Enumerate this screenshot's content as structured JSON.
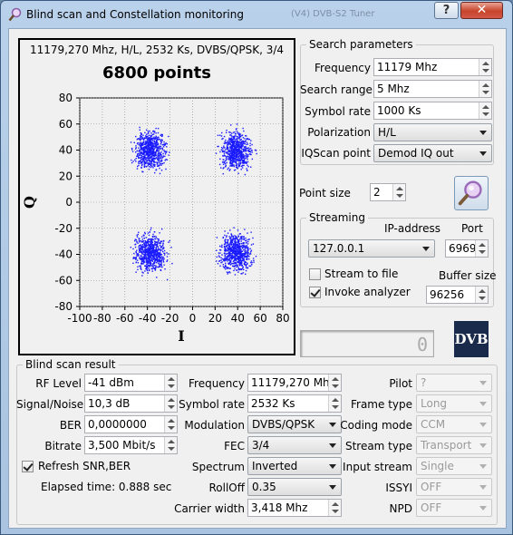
{
  "window": {
    "title": "Blind scan and Constellation monitoring",
    "bg_title": "(V4) DVB-S2 Tuner",
    "help": "?",
    "close": "✕"
  },
  "plot": {
    "header": "11179,270 Mhz, H/L, 2532 Ks, DVBS/QPSK, 3/4",
    "title": "6800 points",
    "xlabel": "I",
    "ylabel": "Q"
  },
  "chart_data": {
    "type": "scatter",
    "title": "6800 points",
    "xlabel": "I",
    "ylabel": "Q",
    "xlim": [
      -100,
      80
    ],
    "ylim": [
      -80,
      80
    ],
    "xticks": [
      -100,
      -80,
      -60,
      -40,
      -20,
      0,
      20,
      40,
      60,
      80
    ],
    "yticks": [
      -80,
      -60,
      -40,
      -20,
      0,
      20,
      40,
      60,
      80
    ],
    "grid": true,
    "point_count": 6800,
    "color": "#1a1aff",
    "clusters": [
      {
        "center": [
          -38,
          40
        ],
        "spread": 10
      },
      {
        "center": [
          38,
          40
        ],
        "spread": 10
      },
      {
        "center": [
          -38,
          -38
        ],
        "spread": 10
      },
      {
        "center": [
          38,
          -38
        ],
        "spread": 10
      }
    ]
  },
  "search": {
    "legend": "Search parameters",
    "frequency_label": "Frequency",
    "frequency_value": "11179 Mhz",
    "range_label": "Search range",
    "range_value": "5 Mhz",
    "symrate_label": "Symbol rate",
    "symrate_value": "1000 Ks",
    "pol_label": "Polarization",
    "pol_value": "H/L",
    "iq_label": "IQScan point",
    "iq_value": "Demod IQ out"
  },
  "pointsize": {
    "label": "Point size",
    "value": "2"
  },
  "streaming": {
    "legend": "Streaming",
    "ip_label": "IP-address",
    "ip_value": "127.0.0.1",
    "port_label": "Port",
    "port_value": "6969",
    "stream_file_label": "Stream to file",
    "invoke_label": "Invoke analyzer",
    "buffer_label": "Buffer size",
    "buffer_value": "96256"
  },
  "status": {
    "value": "0"
  },
  "dvb_logo": "DVB",
  "result": {
    "legend": "Blind scan result",
    "rf_label": "RF Level",
    "rf_value": "-41 dBm",
    "sn_label": "Signal/Noise",
    "sn_value": "10,3 dB",
    "ber_label": "BER",
    "ber_value": "0,0000000",
    "bitrate_label": "Bitrate",
    "bitrate_value": "3,500 Mbit/s",
    "refresh_label": "Refresh SNR,BER",
    "elapsed": "Elapsed time: 0.888 sec",
    "freq_label": "Frequency",
    "freq_value": "11179,270 Mhz",
    "sym_label": "Symbol rate",
    "sym_value": "2532 Ks",
    "mod_label": "Modulation",
    "mod_value": "DVBS/QPSK",
    "fec_label": "FEC",
    "fec_value": "3/4",
    "spec_label": "Spectrum",
    "spec_value": "Inverted",
    "roll_label": "RollOff",
    "roll_value": "0.35",
    "cw_label": "Carrier width",
    "cw_value": "3,418 Mhz",
    "pilot_label": "Pilot",
    "pilot_value": "?",
    "frame_label": "Frame type",
    "frame_value": "Long",
    "coding_label": "Coding mode",
    "coding_value": "CCM",
    "stype_label": "Stream type",
    "stype_value": "Transport",
    "istream_label": "Input stream",
    "istream_value": "Single",
    "issyi_label": "ISSYI",
    "issyi_value": "OFF",
    "npd_label": "NPD",
    "npd_value": "OFF"
  }
}
